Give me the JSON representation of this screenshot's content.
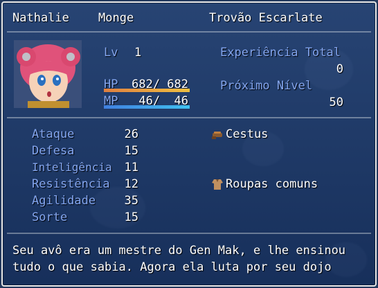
{
  "actor": {
    "name": "Nathalie",
    "class": "Monge",
    "nickname": "Trovão Escarlate"
  },
  "status": {
    "lv_label": "Lv",
    "lv": "1",
    "hp_label": "HP",
    "hp": "682/ 682",
    "hp_ratio": 1.0,
    "mp_label": "MP",
    "mp": " 46/  46",
    "mp_ratio": 1.0,
    "exp_total_label": "Experiência Total",
    "exp_total": "0",
    "next_level_label": "Próximo Nível",
    "next_level": "50"
  },
  "params": [
    {
      "label": "Ataque",
      "value": "26"
    },
    {
      "label": "Defesa",
      "value": "15"
    },
    {
      "label": "Inteligência",
      "value": "11"
    },
    {
      "label": "Resistência",
      "value": "12"
    },
    {
      "label": "Agilidade",
      "value": "35"
    },
    {
      "label": "Sorte",
      "value": "15"
    }
  ],
  "equipment": [
    {
      "icon": "cestus-icon",
      "name": "Cestus"
    },
    {
      "icon": "clothes-icon",
      "name": "Roupas comuns"
    }
  ],
  "profile": {
    "line1": "Seu avô era um mestre do Gen Mak, e lhe ensinou",
    "line2": "tudo o que sabia. Agora ela luta por seu dojo"
  },
  "colors": {
    "system_text": "#84a6f0",
    "hp_gauge": [
      "#e08040",
      "#f0c040"
    ],
    "mp_gauge": [
      "#4080e0",
      "#40c0f0"
    ],
    "gauge_back": "#202040"
  }
}
